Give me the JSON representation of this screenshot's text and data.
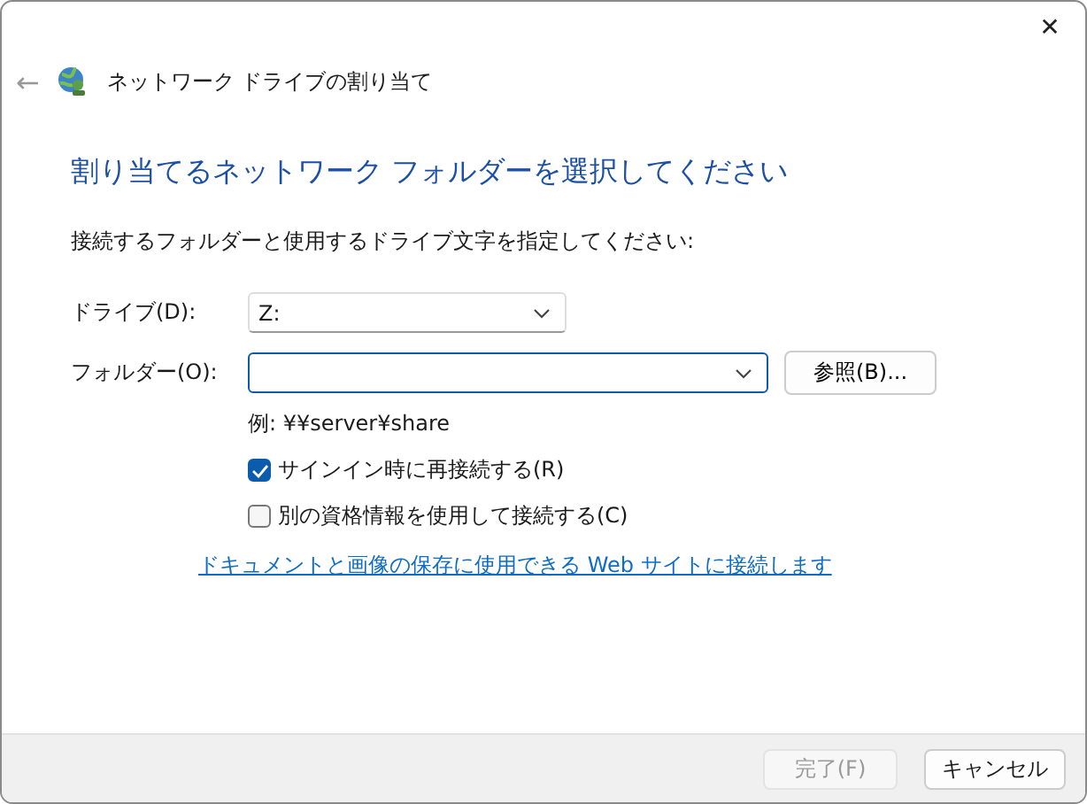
{
  "window": {
    "close": "✕",
    "back": "←",
    "title": "ネットワーク ドライブの割り当て"
  },
  "heading": "割り当てるネットワーク フォルダーを選択してください",
  "instruction": "接続するフォルダーと使用するドライブ文字を指定してください:",
  "drive": {
    "label": "ドライブ(D):",
    "value": "Z:"
  },
  "folder": {
    "label": "フォルダー(O):",
    "browse": "参照(B)..."
  },
  "example": "例: ¥¥server¥share",
  "options": [
    {
      "label": "サインイン時に再接続する(R)",
      "checked": true
    },
    {
      "label": "別の資格情報を使用して接続する(C)",
      "checked": false
    }
  ],
  "link": "ドキュメントと画像の保存に使用できる Web サイトに接続します",
  "buttons": [
    {
      "label": "完了(F)",
      "disabled": true
    },
    {
      "label": "キャンセル",
      "disabled": false
    }
  ]
}
